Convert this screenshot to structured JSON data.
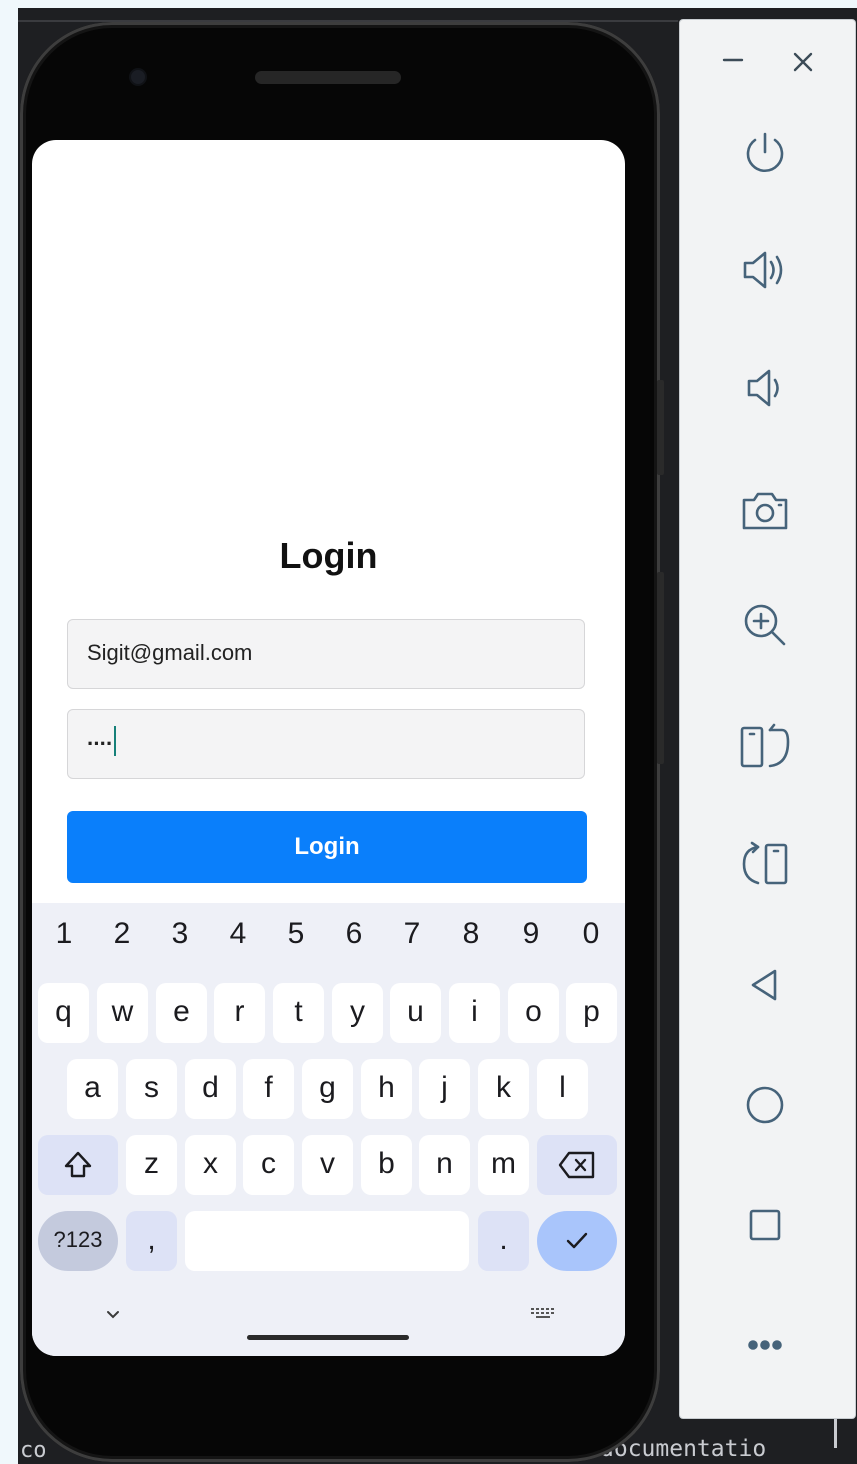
{
  "app": {
    "screen_title": "Login",
    "email_value": "Sigit@gmail.com",
    "password_value": "····",
    "login_button_label": "Login"
  },
  "keyboard": {
    "number_row": [
      "1",
      "2",
      "3",
      "4",
      "5",
      "6",
      "7",
      "8",
      "9",
      "0"
    ],
    "row1": [
      "q",
      "w",
      "e",
      "r",
      "t",
      "y",
      "u",
      "i",
      "o",
      "p"
    ],
    "row2": [
      "a",
      "s",
      "d",
      "f",
      "g",
      "h",
      "j",
      "k",
      "l"
    ],
    "row3": [
      "z",
      "x",
      "c",
      "v",
      "b",
      "n",
      "m"
    ],
    "symbols_key_label": "?123",
    "comma_key_label": ",",
    "period_key_label": "."
  },
  "toolbar": {
    "buttons": [
      "minimize-icon",
      "close-icon",
      "power-icon",
      "volume-up-icon",
      "volume-down-icon",
      "camera-icon",
      "zoom-in-icon",
      "rotate-left-icon",
      "rotate-right-icon",
      "back-icon",
      "home-icon",
      "overview-icon",
      "more-icon"
    ]
  },
  "background": {
    "code_left": "co",
    "code_right": "documentatio"
  },
  "colors": {
    "accent_button": "#0a7ffb",
    "enter_key": "#a9c5fb",
    "toolbar_icon": "#46637a",
    "caret": "#168079"
  }
}
